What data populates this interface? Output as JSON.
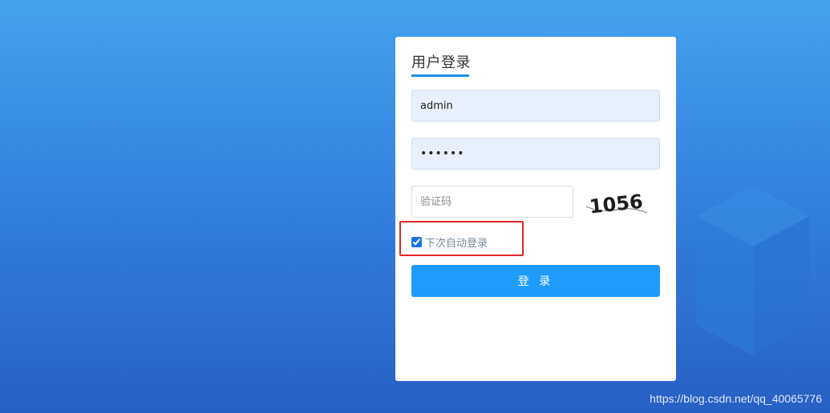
{
  "login": {
    "title": "用户登录",
    "username_value": "admin",
    "password_value": "••••••",
    "captcha_placeholder": "验证码",
    "captcha_text": "1056",
    "remember_label": "下次自动登录",
    "remember_checked": true,
    "submit_label": "登 录"
  },
  "watermark": "https://blog.csdn.net/qq_40065776",
  "colors": {
    "accent": "#1e9bfb",
    "highlight_box": "#e8262a",
    "background_top": "#43a2ee",
    "background_bottom": "#2760c4"
  },
  "icons": {
    "decoration": "cube-icon"
  }
}
